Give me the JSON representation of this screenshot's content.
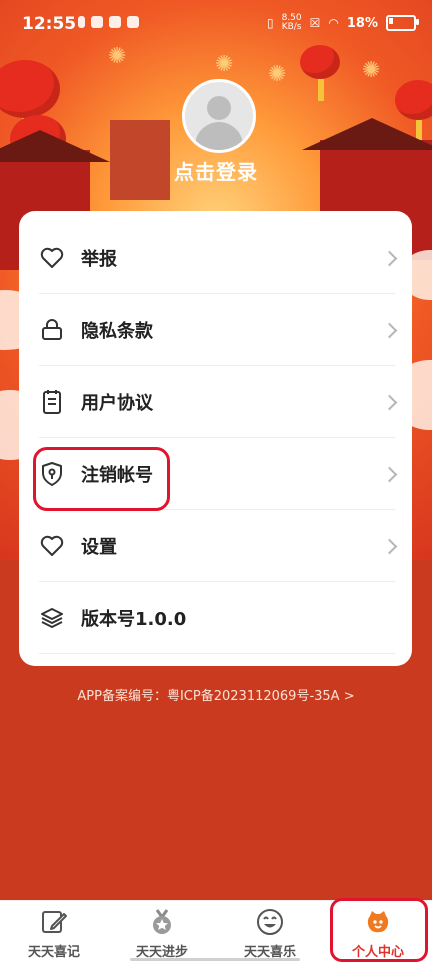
{
  "status_bar": {
    "time": "12:55",
    "speed_value": "8.50",
    "speed_unit": "KB/s",
    "battery": "18%"
  },
  "profile": {
    "login_label": "点击登录"
  },
  "menu": {
    "items": [
      {
        "label": "举报",
        "icon": "heart-icon"
      },
      {
        "label": "隐私条款",
        "icon": "lock-icon"
      },
      {
        "label": "用户协议",
        "icon": "document-icon"
      },
      {
        "label": "注销帐号",
        "icon": "shield-key-icon"
      },
      {
        "label": "设置",
        "icon": "heart-icon"
      },
      {
        "label": "版本号1.0.0",
        "icon": "layers-icon"
      }
    ]
  },
  "footer": {
    "icp_text": "APP备案编号：粤ICP备2023112069号-35A >"
  },
  "tabbar": {
    "tabs": [
      {
        "label": "天天喜记",
        "icon": "edit-icon"
      },
      {
        "label": "天天进步",
        "icon": "medal-icon"
      },
      {
        "label": "天天喜乐",
        "icon": "smile-icon"
      },
      {
        "label": "个人中心",
        "icon": "profile-face-icon",
        "active": true
      }
    ]
  },
  "colors": {
    "accent": "#e0312a",
    "highlight_box": "#e0142f"
  }
}
